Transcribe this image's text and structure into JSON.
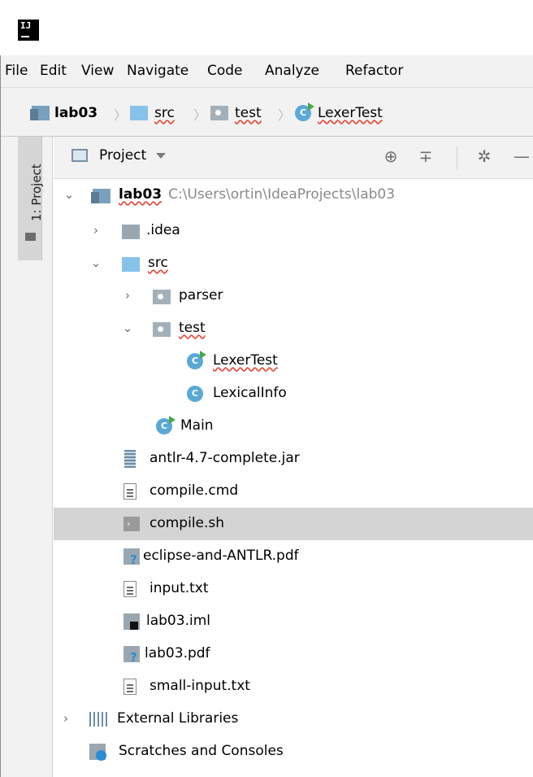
{
  "app": {
    "logo_text": "IJ"
  },
  "menu": [
    {
      "label": "File"
    },
    {
      "label": "Edit"
    },
    {
      "label": "View"
    },
    {
      "label": "Navigate"
    },
    {
      "label": "Code"
    },
    {
      "label": "Analyze"
    },
    {
      "label": "Refactor"
    }
  ],
  "breadcrumb": [
    {
      "label": "lab03"
    },
    {
      "label": "src"
    },
    {
      "label": "test"
    },
    {
      "label": "LexerTest"
    }
  ],
  "tool_window": {
    "tab_label": "1: Project"
  },
  "project_panel": {
    "title": "Project"
  },
  "tree": {
    "root": {
      "label": "lab03",
      "path": "C:\\Users\\ortin\\IdeaProjects\\lab03"
    },
    "items": [
      {
        "label": ".idea"
      },
      {
        "label": "src"
      },
      {
        "label": "parser"
      },
      {
        "label": "test"
      },
      {
        "label": "LexerTest"
      },
      {
        "label": "LexicalInfo"
      },
      {
        "label": "Main"
      },
      {
        "label": "antlr-4.7-complete.jar"
      },
      {
        "label": "compile.cmd"
      },
      {
        "label": "compile.sh"
      },
      {
        "label": "eclipse-and-ANTLR.pdf"
      },
      {
        "label": "input.txt"
      },
      {
        "label": "lab03.iml"
      },
      {
        "label": "lab03.pdf"
      },
      {
        "label": "small-input.txt"
      },
      {
        "label": "External Libraries"
      },
      {
        "label": "Scratches and Consoles"
      }
    ],
    "selected": "compile.sh"
  },
  "colors": {
    "selection": "#d4d4d4",
    "chrome": "#f2f2f2",
    "class_icon": "#5ca8d5",
    "run_marker": "#4aa64a"
  }
}
